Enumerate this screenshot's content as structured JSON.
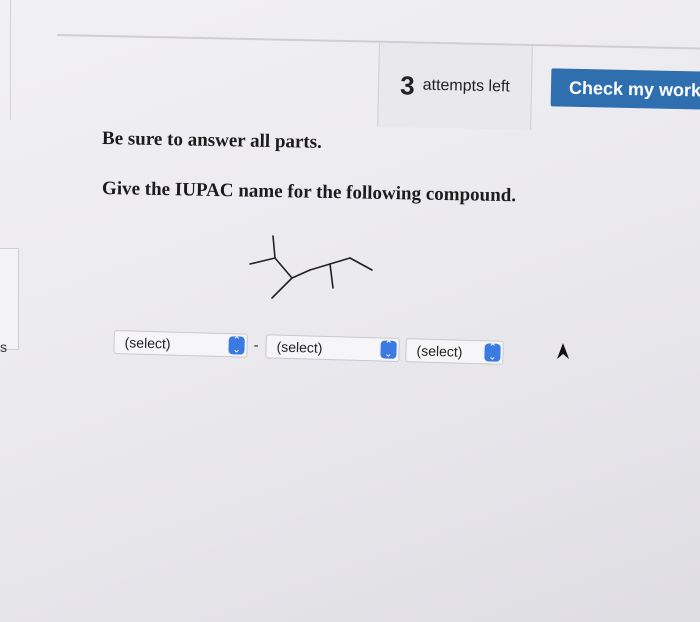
{
  "left_edge": {
    "fragment": "s"
  },
  "header": {
    "attempts_count": "3",
    "attempts_label": "attempts left",
    "check_button_label": "Check my work"
  },
  "instructions": "Be sure to answer all parts.",
  "question": "Give the IUPAC name for the following compound.",
  "structure": {
    "type": "skeletal formula",
    "drawn_as": "line-angle structure"
  },
  "answer": {
    "selects": [
      {
        "value": "(select)"
      },
      {
        "value": "(select)"
      },
      {
        "value": "(select)"
      }
    ],
    "separator": "-"
  },
  "colors": {
    "check_button": "#2f6fb0",
    "select_arrow": "#3b7ae0",
    "text": "#1c1c1c"
  }
}
